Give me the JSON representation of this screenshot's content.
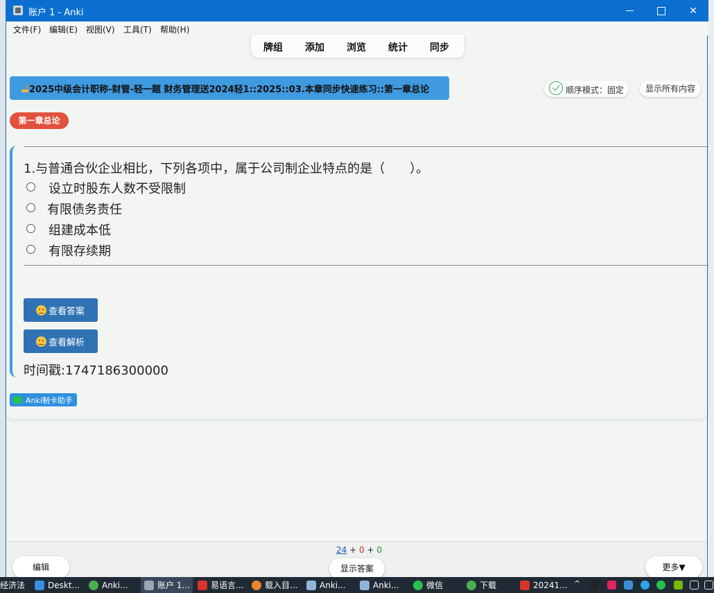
{
  "window": {
    "title": "账户 1 - Anki"
  },
  "menubar": [
    "文件(F)",
    "编辑(E)",
    "视图(V)",
    "工具(T)",
    "帮助(H)"
  ],
  "toptabs": [
    "牌组",
    "添加",
    "浏览",
    "统计",
    "同步"
  ],
  "deck": {
    "path": "2025中级会计职称-财管-轻一题 财务管理送2024轻1::2025::03.本章同步快速练习::第一章总论"
  },
  "mode": {
    "label": "顺序模式：固定"
  },
  "show_all": "显示所有内容",
  "chapter_badge": "第一章总论",
  "question": {
    "text": "1.与普通合伙企业相比，下列各项中，属于公司制企业特点的是（　　）。",
    "options": [
      "设立时股东人数不受限制",
      "有限债务责任",
      "组建成本低",
      "有限存续期"
    ]
  },
  "buttons": {
    "view_answer": "查看答案",
    "view_analysis": "查看解析"
  },
  "timestamp": "时间戳:1747186300000",
  "brand_tag": "Anki制卡助手",
  "bottom": {
    "counts": {
      "new": "24",
      "learn": "0",
      "review": "0",
      "plus": "+"
    },
    "edit": "编辑",
    "show_answer": "显示答案",
    "more": "更多▼"
  },
  "taskbar": {
    "items": [
      "经济法",
      "Deskt...",
      "Anki...",
      "账户 1...",
      "易语言...",
      "载入目...",
      "Anki...",
      "Anki...",
      "微信",
      "下载",
      "20241..."
    ]
  },
  "colors": {
    "accent": "#3f9ae0",
    "badge": "#e2513c",
    "button": "#2f72b4",
    "titlebar": "#0a6fd0"
  }
}
